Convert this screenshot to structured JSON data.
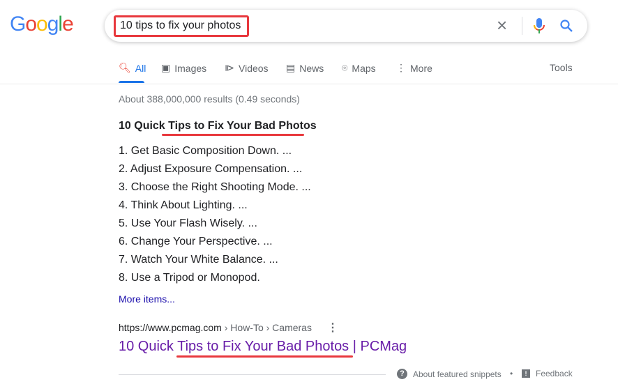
{
  "logo": "Google",
  "search": {
    "query": "10 tips to fix your photos",
    "clear_icon": "close-icon",
    "mic_icon": "mic-icon",
    "search_icon": "search-icon"
  },
  "tabs": [
    {
      "label": "All",
      "icon": "search-icon"
    },
    {
      "label": "Images",
      "icon": "image-icon"
    },
    {
      "label": "Videos",
      "icon": "play-icon"
    },
    {
      "label": "News",
      "icon": "news-icon"
    },
    {
      "label": "Maps",
      "icon": "pin-icon"
    },
    {
      "label": "More",
      "icon": "more-vert-icon"
    }
  ],
  "tools": "Tools",
  "stats": "About 388,000,000 results (0.49 seconds)",
  "snippet": {
    "title": "10 Quick Tips to Fix Your Bad Photos",
    "items": [
      "1. Get Basic Composition Down. ...",
      "2. Adjust Exposure Compensation. ...",
      "3. Choose the Right Shooting Mode. ...",
      "4. Think About Lighting. ...",
      "5. Use Your Flash Wisely. ...",
      "6. Change Your Perspective. ...",
      "7. Watch Your White Balance. ...",
      "8. Use a Tripod or Monopod."
    ],
    "more": "More items..."
  },
  "result": {
    "url": "https://www.pcmag.com",
    "crumbs": " › How-To › Cameras",
    "title": "10 Quick Tips to Fix Your Bad Photos | PCMag"
  },
  "footer": {
    "about": "About featured snippets",
    "sep": "•",
    "feedback": "Feedback"
  },
  "colors": {
    "highlight": "#e8383d",
    "link": "#1a0dab",
    "visited": "#681da8",
    "accent": "#1a73e8"
  }
}
